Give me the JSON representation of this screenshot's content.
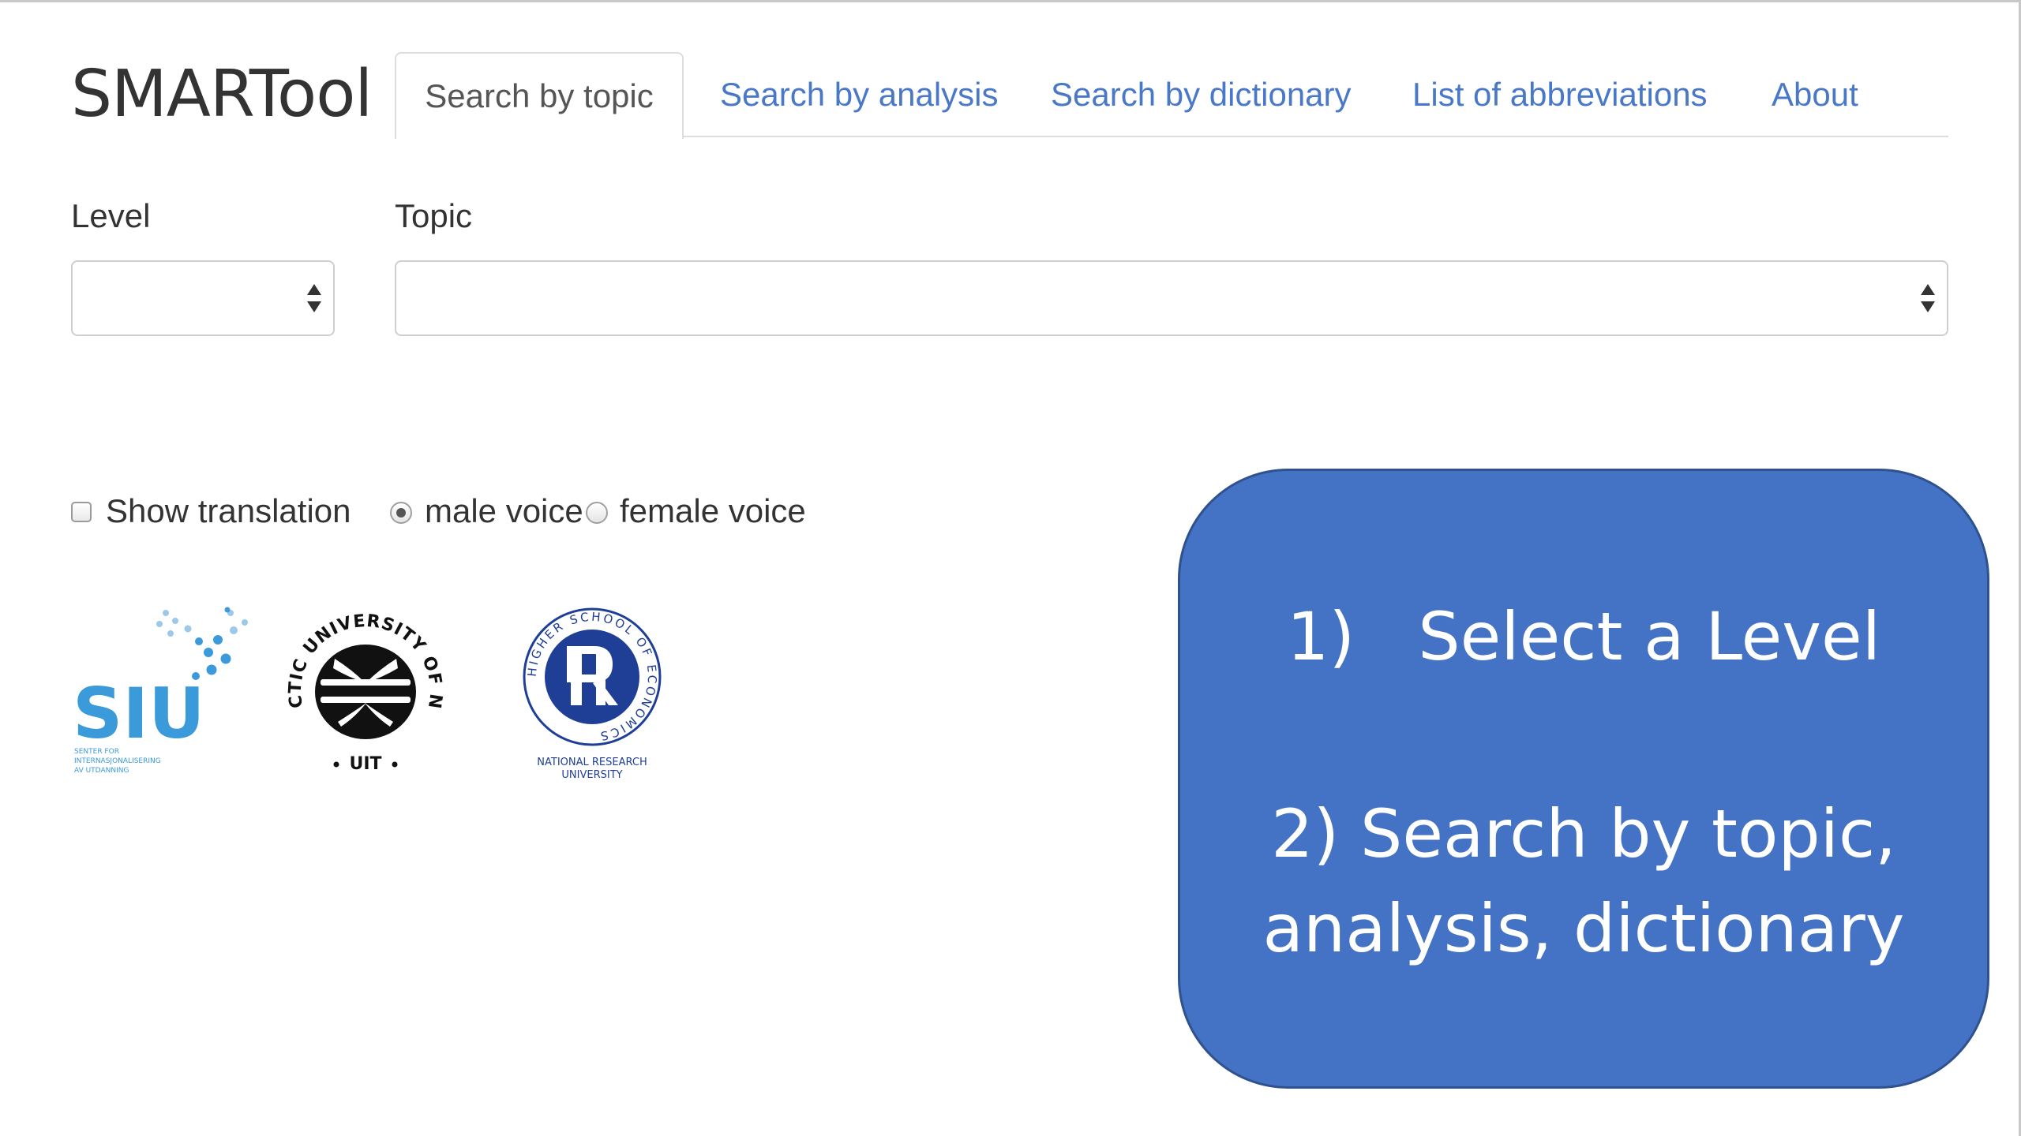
{
  "app": {
    "title": "SMARTool"
  },
  "nav": {
    "tabs": [
      {
        "label": "Search by topic",
        "active": true
      },
      {
        "label": "Search by analysis",
        "active": false
      },
      {
        "label": "Search by dictionary",
        "active": false
      },
      {
        "label": "List of abbreviations",
        "active": false
      },
      {
        "label": "About",
        "active": false
      }
    ]
  },
  "filters": {
    "level": {
      "label": "Level",
      "value": ""
    },
    "topic": {
      "label": "Topic",
      "value": ""
    }
  },
  "options": {
    "show_translation": {
      "label": "Show translation",
      "checked": false
    },
    "voice": {
      "male": {
        "label": "male voice",
        "checked": true
      },
      "female": {
        "label": "female voice",
        "checked": false
      }
    }
  },
  "logos": {
    "siu": {
      "mark": "SIU",
      "caption_lines": [
        "SENTER FOR",
        "INTERNASJONALISERING",
        "AV UTDANNING"
      ]
    },
    "uit": {
      "ring_top": "THE ARCTIC UNIVERSITY OF NORWAY",
      "ring_bottom": "UIT"
    },
    "hse": {
      "ring": "HIGHER SCHOOL OF ECONOMICS",
      "caption_lines": [
        "NATIONAL RESEARCH",
        "UNIVERSITY"
      ]
    }
  },
  "callout": {
    "line1": "1)   Select a Level",
    "line2": "2) Search by topic,",
    "line3": "analysis, dictionary"
  },
  "colors": {
    "link": "#4a78c8",
    "callout_bg": "#4472c4",
    "siu_blue": "#3b9ad9",
    "hse_blue": "#1f3f96"
  }
}
